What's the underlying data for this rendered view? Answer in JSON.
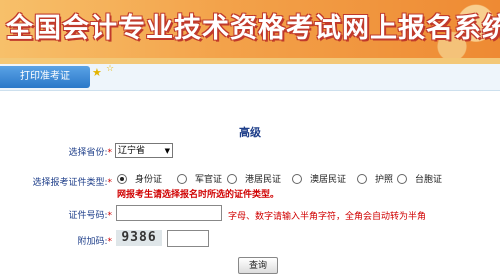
{
  "header": {
    "title": "全国会计专业技术资格考试网上报名系统"
  },
  "nav": {
    "tab_label": "打印准考证",
    "icons": [
      "star-icon",
      "star-icon"
    ]
  },
  "form": {
    "section_title": "高级",
    "province": {
      "label": "选择省份:",
      "required_mark": "*",
      "selected": "辽宁省"
    },
    "id_type": {
      "label": "选择报考证件类型:",
      "required_mark": "*",
      "options": [
        "身份证",
        "军官证",
        "港居民证",
        "澳居民证",
        "护照",
        "台胞证"
      ],
      "selected_index": 0,
      "warning": "网报考生请选择报名时所选的证件类型。"
    },
    "id_number": {
      "label": "证件号码:",
      "required_mark": "*",
      "value": "",
      "hint": "字母、数字请输入半角字符，全角会自动转为半角"
    },
    "captcha": {
      "label": "附加码:",
      "required_mark": "*",
      "image_text": "9386",
      "value": ""
    },
    "submit_label": "查询"
  }
}
